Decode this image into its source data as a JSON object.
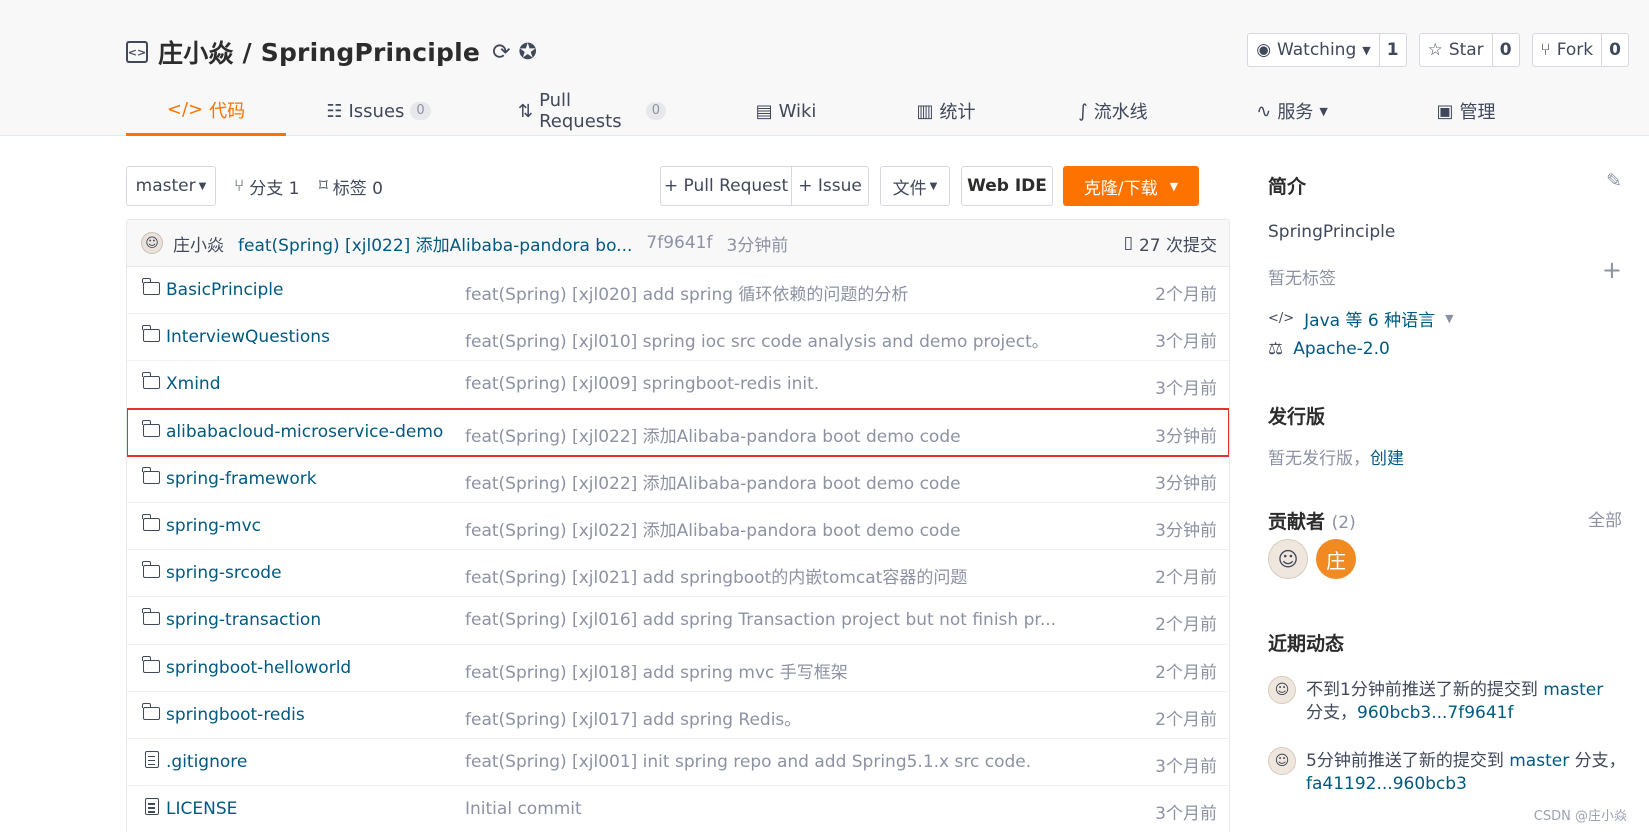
{
  "repo": {
    "owner": "庄小焱",
    "separator": " / ",
    "name": "SpringPrinciple"
  },
  "header_buttons": {
    "watch": {
      "label": "Watching",
      "count": "1"
    },
    "star": {
      "label": "Star",
      "count": "0"
    },
    "fork": {
      "label": "Fork",
      "count": "0"
    }
  },
  "tabs": [
    {
      "label": "代码",
      "badge": ""
    },
    {
      "label": "Issues",
      "badge": "0"
    },
    {
      "label": "Pull Requests",
      "badge": "0"
    },
    {
      "label": "Wiki",
      "badge": ""
    },
    {
      "label": "统计",
      "badge": ""
    },
    {
      "label": "流水线",
      "badge": ""
    },
    {
      "label": "服务",
      "badge": ""
    },
    {
      "label": "管理",
      "badge": ""
    }
  ],
  "toolbar": {
    "branch": "master",
    "branches": "分支 1",
    "tags": "标签 0",
    "pull_request": "+ Pull Request",
    "issue": "+ Issue",
    "file": "文件",
    "web_ide": "Web IDE",
    "clone": "克隆/下载"
  },
  "latest_commit": {
    "author": "庄小焱",
    "message": "feat(Spring) [xjl022] 添加Alibaba-pandora bo...",
    "hash": "7f9641f",
    "time": "3分钟前",
    "count": "27 次提交"
  },
  "files": [
    {
      "name": "BasicPrinciple",
      "type": "folder",
      "message": "feat(Spring) [xjl020] add spring 循环依赖的问题的分析",
      "time": "2个月前"
    },
    {
      "name": "InterviewQuestions",
      "type": "folder",
      "message": "feat(Spring) [xjl010] spring ioc src code analysis and demo project。",
      "time": "3个月前"
    },
    {
      "name": "Xmind",
      "type": "folder",
      "message": "feat(Spring) [xjl009] springboot-redis init.",
      "time": "3个月前"
    },
    {
      "name": "alibabacloud-microservice-demo",
      "type": "folder",
      "message": "feat(Spring) [xjl022] 添加Alibaba-pandora boot demo code",
      "time": "3分钟前"
    },
    {
      "name": "spring-framework",
      "type": "folder",
      "message": "feat(Spring) [xjl022] 添加Alibaba-pandora boot demo code",
      "time": "3分钟前"
    },
    {
      "name": "spring-mvc",
      "type": "folder",
      "message": "feat(Spring) [xjl022] 添加Alibaba-pandora boot demo code",
      "time": "3分钟前"
    },
    {
      "name": "spring-srcode",
      "type": "folder",
      "message": "feat(Spring) [xjl021] add springboot的内嵌tomcat容器的问题",
      "time": "2个月前"
    },
    {
      "name": "spring-transaction",
      "type": "folder",
      "message": "feat(Spring) [xjl016] add spring Transaction project but not finish pr...",
      "time": "2个月前"
    },
    {
      "name": "springboot-helloworld",
      "type": "folder",
      "message": "feat(Spring) [xjl018] add spring mvc 手写框架",
      "time": "2个月前"
    },
    {
      "name": "springboot-redis",
      "type": "folder",
      "message": "feat(Spring) [xjl017] add spring Redis。",
      "time": "2个月前"
    },
    {
      "name": ".gitignore",
      "type": "file",
      "message": "feat(Spring) [xjl001] init spring repo and add Spring5.1.x src code.",
      "time": "3个月前"
    },
    {
      "name": "LICENSE",
      "type": "file",
      "message": "Initial commit",
      "time": "3个月前"
    }
  ],
  "sidebar": {
    "intro_title": "简介",
    "description": "SpringPrinciple",
    "no_tags": "暂无标签",
    "language": "Java 等 6 种语言",
    "license": "Apache-2.0",
    "release_title": "发行版",
    "no_release": "暂无发行版，",
    "create": "创建",
    "contributors_title": "贡献者",
    "contributors_count": "(2)",
    "all": "全部",
    "contributor_initial": "庄",
    "activity_title": "近期动态",
    "activities": [
      {
        "text": "不到1分钟前推送了新的提交到",
        "branch": "master",
        "text2": "分支，",
        "range": "960bcb3...7f9641f"
      },
      {
        "text": "5分钟前推送了新的提交到",
        "branch": "master",
        "text2": "分支，",
        "range": "fa41192...960bcb3"
      }
    ]
  },
  "watermark": "CSDN @庄小焱",
  "colors": {
    "accent": "#fe7300",
    "link": "#005980",
    "highlight_border": "#e63030"
  }
}
